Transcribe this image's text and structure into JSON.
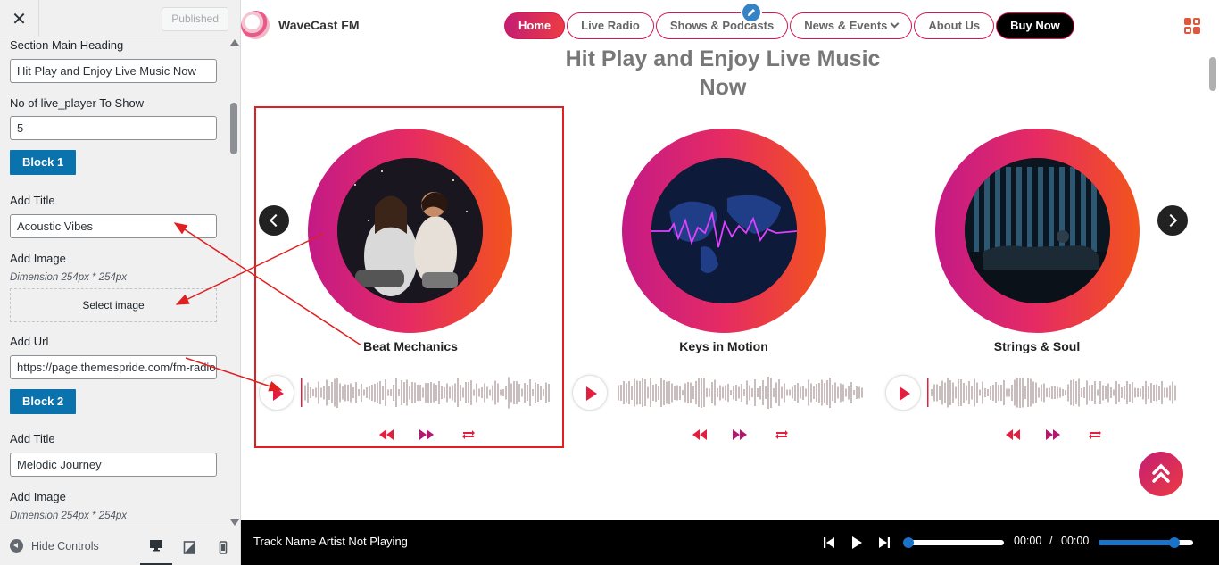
{
  "customizer": {
    "published_label": "Published",
    "section_heading_label": "Section Main Heading",
    "section_heading_value": "Hit Play and Enjoy Live Music Now",
    "count_label": "No of live_player To Show",
    "count_value": "5",
    "block1_label": "Block 1",
    "block1": {
      "title_label": "Add Title",
      "title_value": "Acoustic Vibes",
      "image_label": "Add Image",
      "dimension_note": "Dimension 254px * 254px",
      "select_image_label": "Select image",
      "url_label": "Add Url",
      "url_value": "https://page.themespride.com/fm-radio"
    },
    "block2_label": "Block 2",
    "block2": {
      "title_label": "Add Title",
      "title_value": "Melodic Journey",
      "image_label": "Add Image",
      "dimension_note": "Dimension 254px * 254px"
    },
    "hide_controls_label": "Hide Controls"
  },
  "site": {
    "brand": "WaveCast FM",
    "menu": [
      {
        "label": "Home"
      },
      {
        "label": "Live Radio"
      },
      {
        "label": "Shows & Podcasts"
      },
      {
        "label": "News & Events"
      },
      {
        "label": "About Us"
      },
      {
        "label": "Buy Now"
      }
    ],
    "heading_line1": "Hit Play and Enjoy Live Music",
    "heading_line2": "Now",
    "cards": [
      {
        "title": "Beat Mechanics"
      },
      {
        "title": "Keys in Motion"
      },
      {
        "title": "Strings & Soul"
      }
    ]
  },
  "player": {
    "track_text": "Track Name Artist Not Playing",
    "current_time": "00:00",
    "separator": "/",
    "duration": "00:00",
    "volume": 0.8
  },
  "colors": {
    "accent": "#d41952",
    "gradient_start": "#c41a86",
    "gradient_end": "#f2541b",
    "customizer_button": "#0a72ad",
    "annotation": "#e02020"
  }
}
